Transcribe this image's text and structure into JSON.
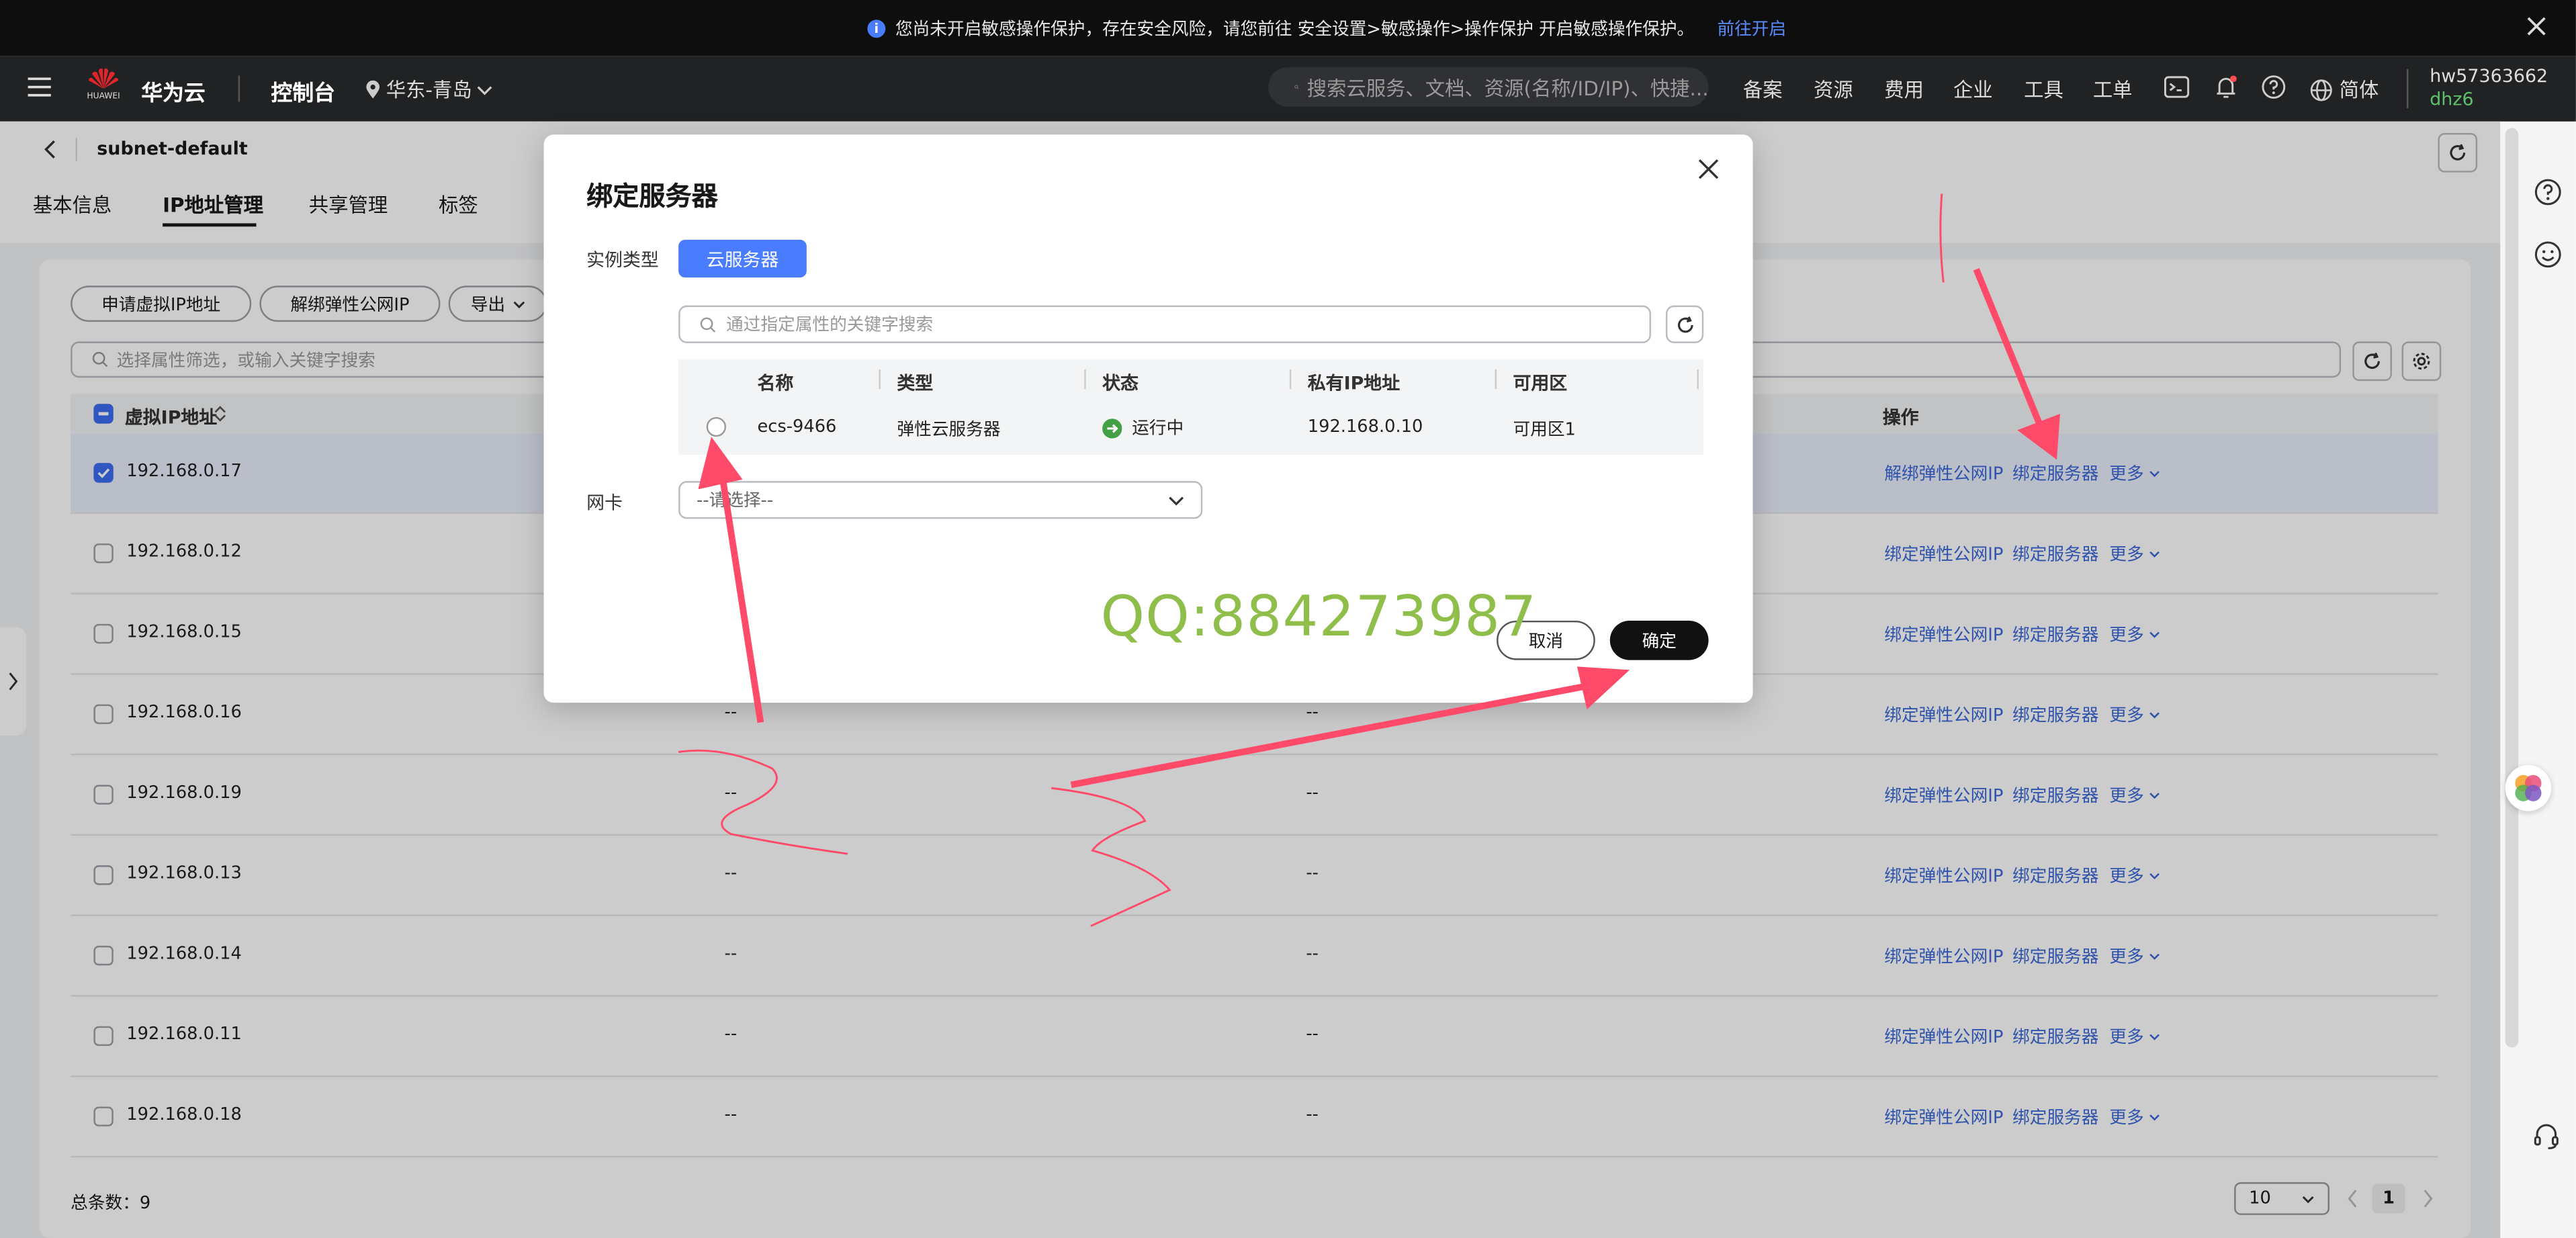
{
  "notice": {
    "message": "您尚未开启敏感操作保护，存在安全风险，请您前往 安全设置>敏感操作>操作保护 开启敏感操作保护。",
    "link": "前往开启"
  },
  "topnav": {
    "brand": "华为云",
    "brand_small": "HUAWEI",
    "console": "控制台",
    "region": "华东-青岛",
    "search_placeholder": "搜索云服务、文档、资源(名称/ID/IP)、快捷...",
    "menu": [
      "备案",
      "资源",
      "费用",
      "企业",
      "工具",
      "工单"
    ],
    "language": "简体",
    "user_name": "hw57363662",
    "user_sub": "dhz6"
  },
  "header": {
    "title": "subnet-default",
    "tabs": [
      "基本信息",
      "IP地址管理",
      "共享管理",
      "标签"
    ],
    "active_tab": "IP地址管理"
  },
  "toolbar": {
    "apply_vip": "申请虚拟IP地址",
    "unbind_eip": "解绑弹性公网IP",
    "export": "导出",
    "filter_placeholder": "选择属性筛选，或输入关键字搜索"
  },
  "table": {
    "columns": {
      "vip": "虚拟IP地址",
      "ops": "操作"
    },
    "rows": [
      {
        "ip": "192.168.0.17",
        "c2": "",
        "c3": "",
        "ops": [
          "解绑弹性公网IP",
          "绑定服务器",
          "更多"
        ],
        "checked": true
      },
      {
        "ip": "192.168.0.12",
        "c2": "",
        "c3": "",
        "ops": [
          "绑定弹性公网IP",
          "绑定服务器",
          "更多"
        ],
        "checked": false
      },
      {
        "ip": "192.168.0.15",
        "c2": "",
        "c3": "",
        "ops": [
          "绑定弹性公网IP",
          "绑定服务器",
          "更多"
        ],
        "checked": false
      },
      {
        "ip": "192.168.0.16",
        "c2": "--",
        "c3": "--",
        "ops": [
          "绑定弹性公网IP",
          "绑定服务器",
          "更多"
        ],
        "checked": false
      },
      {
        "ip": "192.168.0.19",
        "c2": "--",
        "c3": "--",
        "ops": [
          "绑定弹性公网IP",
          "绑定服务器",
          "更多"
        ],
        "checked": false
      },
      {
        "ip": "192.168.0.13",
        "c2": "--",
        "c3": "--",
        "ops": [
          "绑定弹性公网IP",
          "绑定服务器",
          "更多"
        ],
        "checked": false
      },
      {
        "ip": "192.168.0.14",
        "c2": "--",
        "c3": "--",
        "ops": [
          "绑定弹性公网IP",
          "绑定服务器",
          "更多"
        ],
        "checked": false
      },
      {
        "ip": "192.168.0.11",
        "c2": "--",
        "c3": "--",
        "ops": [
          "绑定弹性公网IP",
          "绑定服务器",
          "更多"
        ],
        "checked": false
      },
      {
        "ip": "192.168.0.18",
        "c2": "--",
        "c3": "--",
        "ops": [
          "绑定弹性公网IP",
          "绑定服务器",
          "更多"
        ],
        "checked": false
      }
    ]
  },
  "footer": {
    "total": "总条数：9",
    "page_size": "10",
    "current_page": "1"
  },
  "modal": {
    "title": "绑定服务器",
    "instance_type_label": "实例类型",
    "instance_type_value": "云服务器",
    "search_placeholder": "通过指定属性的关键字搜索",
    "columns": [
      "名称",
      "类型",
      "状态",
      "私有IP地址",
      "可用区"
    ],
    "rows": [
      {
        "name": "ecs-9466",
        "type": "弹性云服务器",
        "status": "运行中",
        "ip": "192.168.0.10",
        "az": "可用区1"
      }
    ],
    "nic_label": "网卡",
    "nic_placeholder": "--请选择--",
    "cancel": "取消",
    "confirm": "确定"
  },
  "watermark": "QQ:884273987",
  "colors": {
    "accent": "#4a7cff",
    "link": "#3b68d8",
    "annotation": "#ff4a6a",
    "watermark": "#8fbe4a",
    "running": "#43a047"
  }
}
